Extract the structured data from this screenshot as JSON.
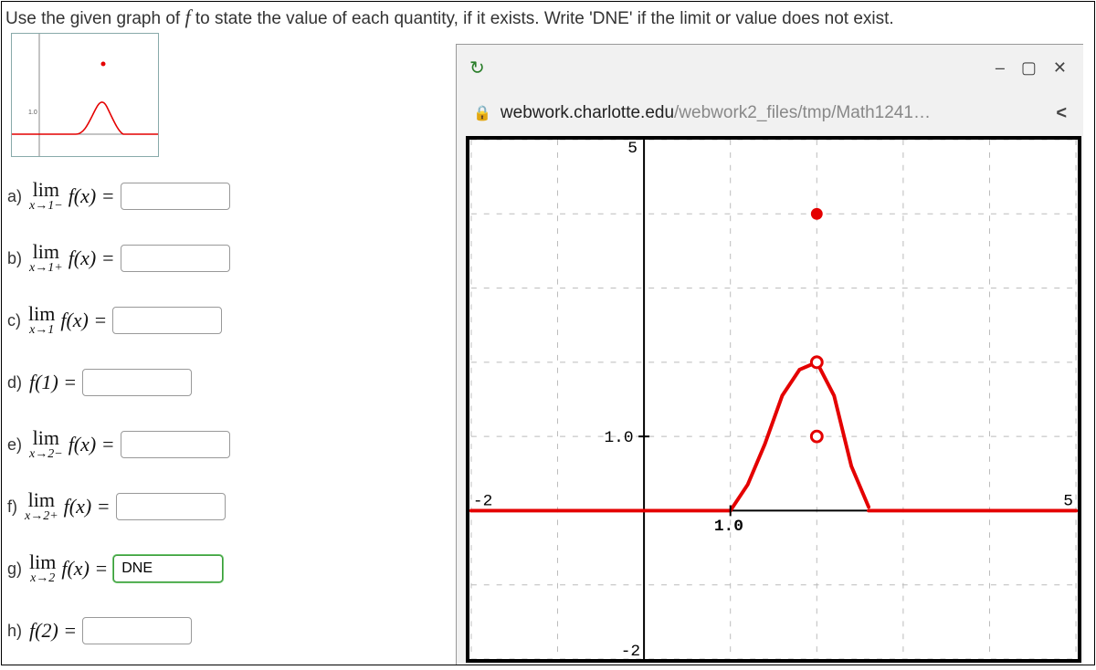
{
  "instruction_pre": "Use the given graph of ",
  "instruction_fn": "f",
  "instruction_post": " to state the value of each quantity, if it exists. Write 'DNE' if the limit or value does not exist.",
  "questions": {
    "a": {
      "label": "a)",
      "limtop": "lim",
      "limbot": "x→1−",
      "expr": "f(x) =",
      "value": ""
    },
    "b": {
      "label": "b)",
      "limtop": "lim",
      "limbot": "x→1+",
      "expr": "f(x) =",
      "value": ""
    },
    "c": {
      "label": "c)",
      "limtop": "lim",
      "limbot": "x→1",
      "expr": "f(x) =",
      "value": ""
    },
    "d": {
      "label": "d)",
      "plain": "f(1) =",
      "value": ""
    },
    "e": {
      "label": "e)",
      "limtop": "lim",
      "limbot": "x→2−",
      "expr": "f(x) =",
      "value": ""
    },
    "f": {
      "label": "f)",
      "limtop": "lim",
      "limbot": "x→2+",
      "expr": "f(x) =",
      "value": ""
    },
    "g": {
      "label": "g)",
      "limtop": "lim",
      "limbot": "x→2",
      "expr": "f(x) =",
      "value": "DNE"
    },
    "h": {
      "label": "h)",
      "plain": "f(2) =",
      "value": ""
    }
  },
  "popup": {
    "url_host": "webwork.charlotte.edu",
    "url_path": "/webwork2_files/tmp/Math1241…",
    "minimize": "–",
    "maximize": "▢",
    "close": "✕",
    "lock": "🔒",
    "share": "<"
  },
  "chart_data": {
    "type": "line",
    "title": "",
    "xlabel": "",
    "ylabel": "",
    "xlim": [
      -2,
      5
    ],
    "ylim": [
      -2,
      5
    ],
    "x_ticks": [
      -2,
      5
    ],
    "y_ticks": [
      -2,
      5
    ],
    "origin_label_x": "1.0",
    "origin_label_y": "1.0",
    "series": [
      {
        "name": "f-left-flat",
        "type": "line",
        "x": [
          -2,
          1
        ],
        "y": [
          0,
          0
        ],
        "color": "#e40000"
      },
      {
        "name": "f-right-flat",
        "type": "line",
        "x": [
          2.6,
          5
        ],
        "y": [
          0,
          0
        ],
        "color": "#e40000"
      },
      {
        "name": "f-hump",
        "type": "line",
        "x": [
          1.0,
          1.2,
          1.4,
          1.6,
          1.8,
          2.0,
          2.2,
          2.4,
          2.6
        ],
        "y": [
          0.0,
          0.35,
          0.9,
          1.55,
          1.9,
          2.0,
          1.55,
          0.6,
          0.05
        ],
        "color": "#e40000"
      }
    ],
    "points": [
      {
        "name": "open-at-2-top",
        "x": 2,
        "y": 2,
        "open": true,
        "color": "#e40000"
      },
      {
        "name": "open-at-2-bottom",
        "x": 2,
        "y": 1,
        "open": true,
        "color": "#e40000"
      },
      {
        "name": "filled-value-2",
        "x": 2,
        "y": 4,
        "open": false,
        "color": "#e40000"
      }
    ]
  }
}
